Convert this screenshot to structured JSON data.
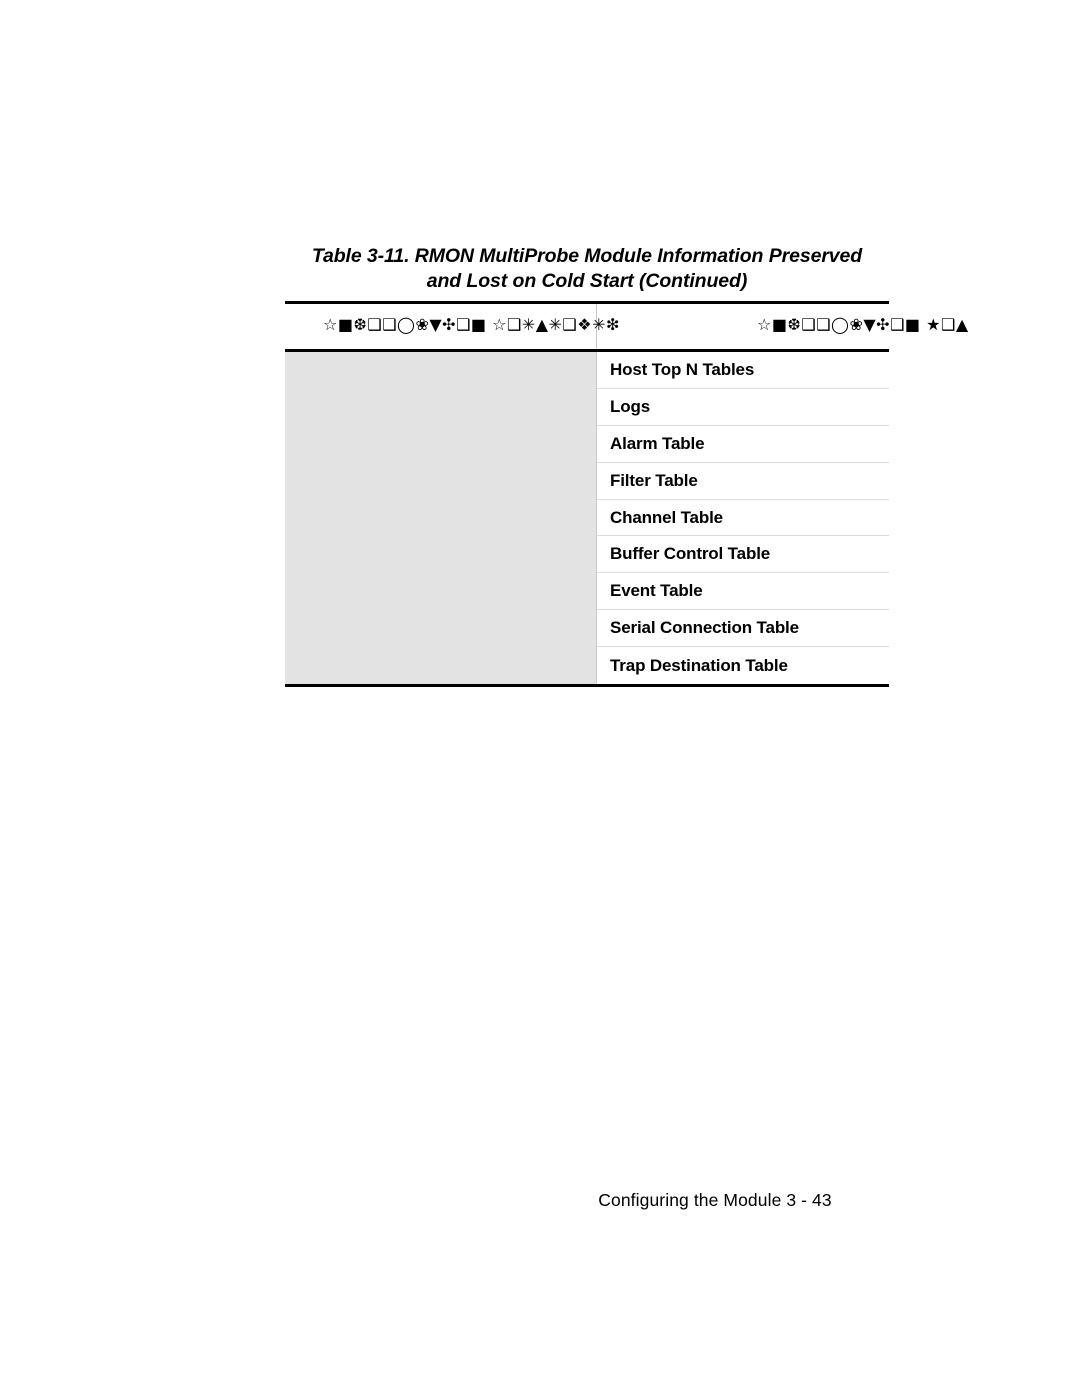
{
  "document": {
    "table_caption": {
      "line1": "Table 3-11.  RMON MultiProbe Module Information Preserved",
      "line2": "and Lost on Cold Start (Continued)"
    },
    "table": {
      "headers": {
        "left": "☆■❆❑❑◯❀▼✣❑■ ☆❑✳▲✳❑❖✳❇",
        "right": "☆■❆❑❑◯❀▼✣❑■ ★❑▲"
      },
      "left_column_cell": "",
      "rows": [
        {
          "label": "Host Top N Tables"
        },
        {
          "label": "Logs"
        },
        {
          "label": "Alarm Table"
        },
        {
          "label": "Filter Table"
        },
        {
          "label": "Channel Table"
        },
        {
          "label": "Buffer Control Table"
        },
        {
          "label": "Event Table"
        },
        {
          "label": "Serial Connection Table"
        },
        {
          "label": "Trap Destination Table"
        }
      ]
    },
    "footer": {
      "text": "Configuring the Module  3 - 43"
    },
    "colors": {
      "page_background": "#ffffff",
      "text": "#000000",
      "shaded_cell": "#e3e3e3",
      "rule_heavy": "#000000",
      "rule_light": "#dcdcdc",
      "divider_vertical": "#c9c9c9"
    }
  }
}
